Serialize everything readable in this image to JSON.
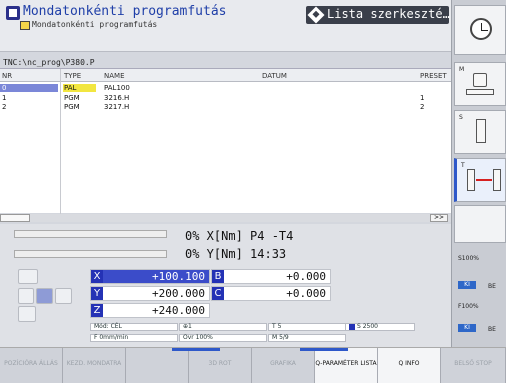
{
  "header": {
    "mode_title": "Mondatonkénti programfutás",
    "mode_subtitle": "Mondatonkénti programfutás",
    "secondary_mode": "Lista szerkeszté…"
  },
  "path": "TNC:\\nc_prog\\P380.P",
  "table": {
    "columns": [
      "NR",
      "TYPE",
      "NAME",
      "DATUM",
      "PRESET"
    ],
    "rows": [
      {
        "nr": "0",
        "type": "PAL",
        "name": "PAL100",
        "datum": "",
        "preset": ""
      },
      {
        "nr": "1",
        "type": "PGM",
        "name": "3216.H",
        "datum": "",
        "preset": "1"
      },
      {
        "nr": "2",
        "type": "PGM",
        "name": "3217.H",
        "datum": "",
        "preset": "2"
      }
    ],
    "scroll_arrow": ">>"
  },
  "status": {
    "line1": "0% X[Nm] P4  -T4",
    "line2": "0% Y[Nm] 14:33"
  },
  "axes": [
    {
      "label": "X",
      "value": "+100.100"
    },
    {
      "label": "Y",
      "value": "+200.000"
    },
    {
      "label": "Z",
      "value": "+240.000"
    },
    {
      "label": "B",
      "value": "+0.000"
    },
    {
      "label": "C",
      "value": "+0.000"
    }
  ],
  "info": {
    "mode": "Mód: CÉL",
    "feed": "F 0mm/min",
    "ovr": "Ovr 100%",
    "tool_icon_value": "1",
    "t": "T 5",
    "s": "S 2500",
    "m": "M 5/9"
  },
  "softkeys": [
    {
      "label": "POZÍCIÓRA ÁLLÁS",
      "active": false
    },
    {
      "label": "KEZD. MONDATRA",
      "active": false
    },
    {
      "label": "",
      "active": false
    },
    {
      "label": "3D ROT",
      "active": false
    },
    {
      "label": "GRAFIKA",
      "active": false
    },
    {
      "label": "Q-PARAMÉTER LISTA",
      "active": true
    },
    {
      "label": "Q INFO",
      "active": true
    },
    {
      "label": "BELSŐ STOP",
      "active": false
    }
  ],
  "right_panel": {
    "m_label": "M",
    "s_label": "S",
    "t_label": "T",
    "s_override": "S100%",
    "f_override": "F100%",
    "ki": "KI",
    "be": "BE"
  }
}
